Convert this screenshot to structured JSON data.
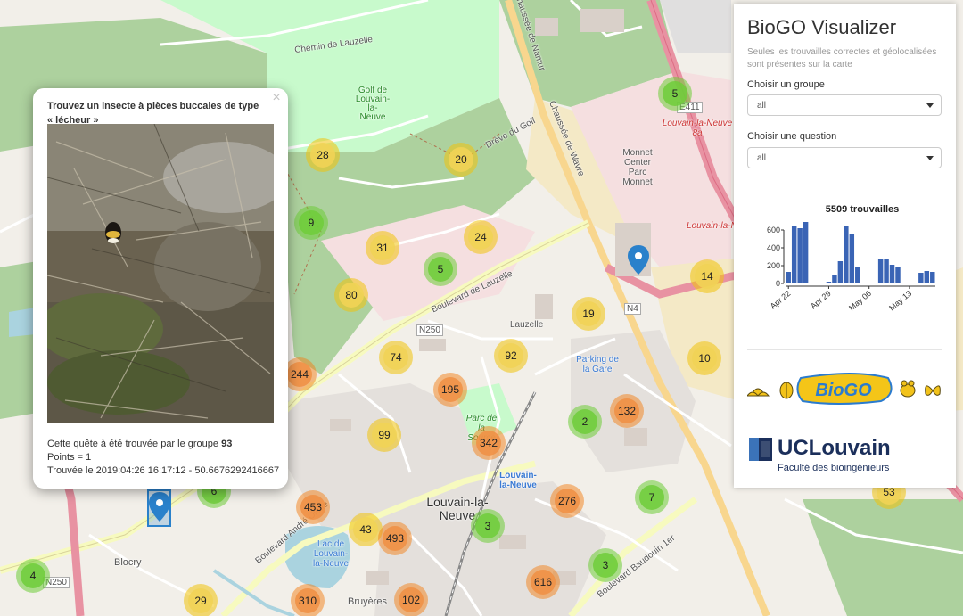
{
  "app": {
    "title": "BioGO Visualizer",
    "subtitle": "Seules les trouvailles correctes et géolocalisées sont présentes sur la carte"
  },
  "filters": {
    "group_label": "Choisir un groupe",
    "group_value": "all",
    "question_label": "Choisir une question",
    "question_value": "all"
  },
  "chart_data": {
    "type": "bar",
    "title": "5509 trouvailles",
    "ylim": [
      0,
      700
    ],
    "yticks": [
      0,
      200,
      400,
      600
    ],
    "xticks": [
      "Apr 22",
      "Apr 29",
      "May 06",
      "May 13"
    ],
    "x": [
      "2019-04-22",
      "2019-04-23",
      "2019-04-24",
      "2019-04-25",
      "2019-04-26",
      "2019-04-27",
      "2019-04-28",
      "2019-04-29",
      "2019-04-30",
      "2019-05-01",
      "2019-05-02",
      "2019-05-03",
      "2019-05-04",
      "2019-05-05",
      "2019-05-06",
      "2019-05-07",
      "2019-05-08",
      "2019-05-09",
      "2019-05-10",
      "2019-05-11",
      "2019-05-12",
      "2019-05-13",
      "2019-05-14",
      "2019-05-15",
      "2019-05-16",
      "2019-05-17"
    ],
    "values": [
      130,
      640,
      620,
      690,
      0,
      0,
      0,
      20,
      90,
      250,
      650,
      560,
      190,
      0,
      0,
      10,
      280,
      270,
      210,
      190,
      0,
      0,
      10,
      120,
      140,
      130
    ],
    "series": [
      {
        "values": [
          130,
          640,
          620,
          690,
          0,
          0,
          0,
          20,
          90,
          250,
          650,
          560,
          190,
          0,
          0,
          10,
          280,
          270,
          210,
          190,
          0,
          0,
          10,
          120,
          140,
          130
        ]
      }
    ],
    "grid": false,
    "color": "#3a64b5"
  },
  "popup": {
    "title": "Trouvez un insecte à pièces buccales de type « lécheur »",
    "close": "×",
    "line1_prefix": "Cette quête à été trouvée par le groupe",
    "group_number": "93",
    "line2": "Points = 1",
    "line3": "Trouvée le 2019:04:26 16:17:12 - 50.6676292416667"
  },
  "clusters": [
    "5",
    "28",
    "20",
    "9",
    "24",
    "31",
    "5",
    "80",
    "14",
    "19",
    "74",
    "92",
    "10",
    "244",
    "195",
    "132",
    "2",
    "99",
    "342",
    "6",
    "7",
    "276",
    "453",
    "43",
    "493",
    "3",
    "3",
    "616",
    "4",
    "29",
    "310",
    "102",
    "53"
  ],
  "map_labels": {
    "golf": "Golf de Louvain-la-Neuve",
    "lln_center": "Louvain-la-Neuve",
    "lln_station": "Louvain-la-Neuve",
    "monnet": "Monnet Center Parc Monnet",
    "lln_8a": "Louvain-la-Neuve 8a",
    "lln_east": "Louvain-la-Neuve",
    "boulevard_lauzelle": "Boulevard de Lauzelle",
    "chaussee_wavre": "Chaussée de Wavre",
    "chaussee_namur": "Chaussée de Namur",
    "chemin_lauzelle": "Chemin de Lauzelle",
    "n250": "N250",
    "n4": "N4",
    "parking": "Parking de la Gare",
    "lauzelle": "Lauzelle",
    "parc_source": "Parc de la Source",
    "lac": "Lac de Louvain-la-Neuve",
    "blocry": "Blocry",
    "bruyeres": "Bruyères",
    "bd_olieffe": "Boulevard André Oleffe",
    "bd_baudouin": "Boulevard Baudouin 1er",
    "drive_golf": "Drève du Golf",
    "e411": "E411"
  },
  "logos": {
    "biogo": "BioGO",
    "uclouvain": "UCLouvain",
    "faculty": "Faculté des bioingénieurs"
  }
}
